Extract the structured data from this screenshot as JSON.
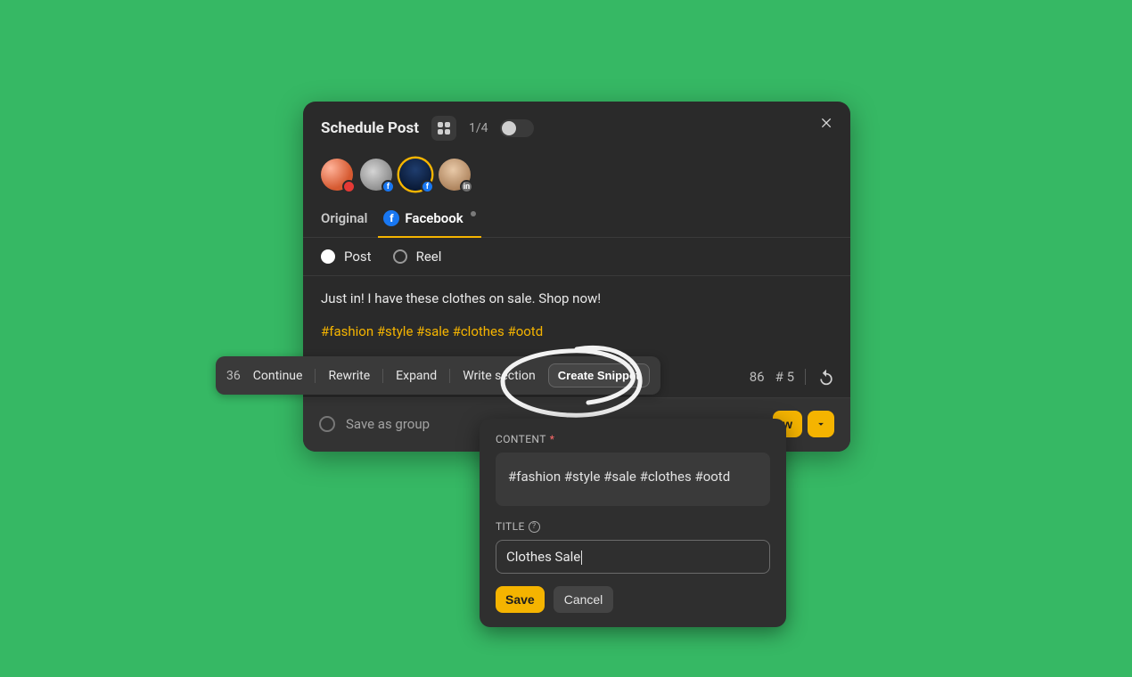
{
  "header": {
    "title": "Schedule Post",
    "page_counter": "1/4"
  },
  "tabs": {
    "original": "Original",
    "facebook": "Facebook"
  },
  "post_type": {
    "post": "Post",
    "reel": "Reel"
  },
  "editor": {
    "body": "Just in! I have these clothes on sale. Shop now!",
    "hashtags": "#fashion #style #sale #clothes #ootd"
  },
  "stats": {
    "char_count": "86",
    "hash_count": "# 5"
  },
  "footer": {
    "save_group": "Save as group",
    "primary_btn": "w"
  },
  "float_bar": {
    "selection_count": "36",
    "continue": "Continue",
    "rewrite": "Rewrite",
    "expand": "Expand",
    "write_section": "Write section",
    "create_snippet": "Create Snippet"
  },
  "popover": {
    "content_label": "CONTENT",
    "content_value": "#fashion #style #sale #clothes #ootd",
    "title_label": "TITLE",
    "title_value": "Clothes Sale",
    "save": "Save",
    "cancel": "Cancel"
  },
  "icons": {
    "plus": "plus-icon",
    "attach": "paperclip-icon",
    "chat": "chat-icon",
    "robot": "robot-icon",
    "hash": "hash-icon",
    "tag": "tag-icon",
    "emoji": "emoji-icon",
    "camera": "camera-icon",
    "eye": "eye-icon",
    "undo": "undo-icon"
  }
}
